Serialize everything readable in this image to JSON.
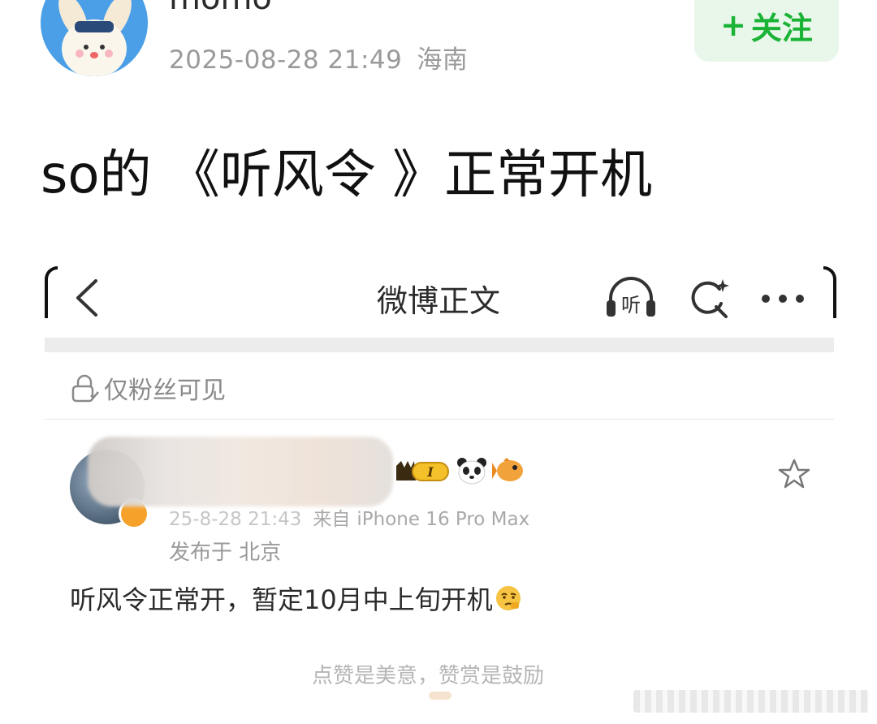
{
  "post": {
    "username": "momo",
    "timestamp": "2025-08-28 21:49",
    "location": "海南",
    "follow_plus": "+",
    "follow_label": "关注",
    "headline": "so的 《听风令 》正常开机"
  },
  "screenshot": {
    "nav_title": "微博正文",
    "listen_label": "听",
    "visibility": "仅粉丝可见",
    "inner_time": "25-8-28 21:43",
    "inner_source": "来自",
    "inner_device": "iPhone 16 Pro Max",
    "inner_location": "发布于 北京",
    "vip_level": "I",
    "inner_text": "听风令正常开，暂定10月中上旬开机",
    "footer": "点赞是美意，赞赏是鼓励"
  },
  "colors": {
    "follow_green": "#1bb336",
    "follow_bg": "#e9f7ea",
    "verify_orange": "#f5a12a"
  },
  "icons": [
    "back-chevron-icon",
    "headphone-listen-icon",
    "search-icon",
    "more-icon",
    "lock-icon",
    "star-icon",
    "panda-icon",
    "fish-icon",
    "thinking-emoji-icon"
  ]
}
